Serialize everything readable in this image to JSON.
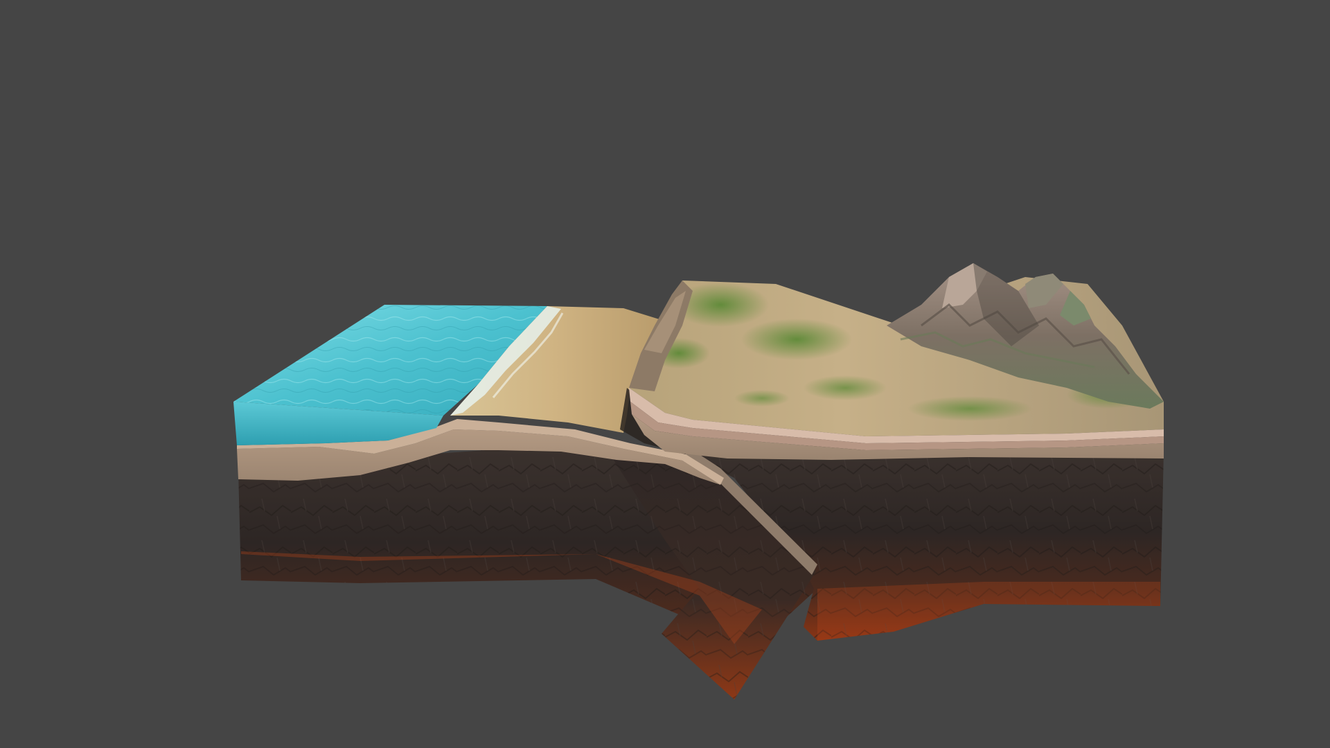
{
  "scene": {
    "background_color": "#454545",
    "subject": "subduction-zone-block-model",
    "colors": {
      "ocean_light": "#6fd3df",
      "ocean_mid": "#3fb9c8",
      "ocean_deep": "#2a9fb0",
      "foam": "#e8f2ee",
      "sand_light": "#d9c08c",
      "sand_mid": "#c7a772",
      "sand_dark": "#a88a5c",
      "crust_stripe": "#b59a84",
      "crust_edge": "#d6b9a4",
      "sediment_layer": "#9c8873",
      "mantle_top": "#3a302c",
      "mantle_mid": "#2e2624",
      "mantle_bottom": "#7a2a12",
      "magma": "#b8441a",
      "grass": "#5f8a3a",
      "grass_light": "#8aa24e",
      "plain": "#c4ae84",
      "mountain_dark": "#6a6058",
      "mountain_mid": "#8c7a6c",
      "mountain_light": "#b39c8a",
      "mountain_green": "#6f8460"
    }
  }
}
